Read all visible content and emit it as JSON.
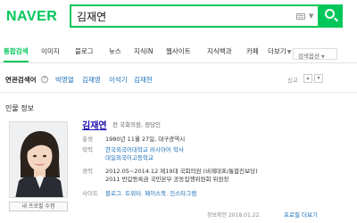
{
  "header": {
    "logo_text": "NAVER",
    "search_value": "김재연",
    "search_placeholder": ""
  },
  "tabs": [
    {
      "label": "통합검색",
      "active": true
    },
    {
      "label": "이미지"
    },
    {
      "label": "블로그"
    },
    {
      "label": "뉴스"
    },
    {
      "label": "지식iN"
    },
    {
      "label": "웹사이트"
    },
    {
      "label": "지식백과"
    },
    {
      "label": "카페"
    },
    {
      "label": "더보기"
    }
  ],
  "search_options_label": "검색옵션",
  "related": {
    "label": "연관검색어",
    "help_glyph": "?",
    "items": [
      "박영열",
      "김재영",
      "이석기",
      "김재현"
    ],
    "report_label": "신고"
  },
  "person": {
    "section_title": "인물 정보",
    "name": "김재연",
    "role": "전 국회의원, 정당인",
    "photo_caption": "내 프로필 수정",
    "rows": [
      {
        "key": "출생",
        "value": "1980년 11월 27일, 대구광역시"
      },
      {
        "key": "학력",
        "value": "한국외국어대학교 러시아어 학사",
        "value2": "대일외국어고등학교"
      },
      {
        "key": "경력",
        "value": "2012.05~2014.12 제19대 국회의원 (비례대표/통합진보당)",
        "value2": "2011 반값등록금 국민본부 공동집행위원회 위원장"
      }
    ],
    "sites": {
      "key": "사이트",
      "links": [
        "블로그",
        "트위터",
        "페이스북",
        "인스타그램"
      ]
    },
    "info_date": "정보확인 2018.01.22.",
    "more_link": "프로필 더보기"
  },
  "colors": {
    "brand": "#03c75a",
    "link": "#1a6fb8"
  }
}
